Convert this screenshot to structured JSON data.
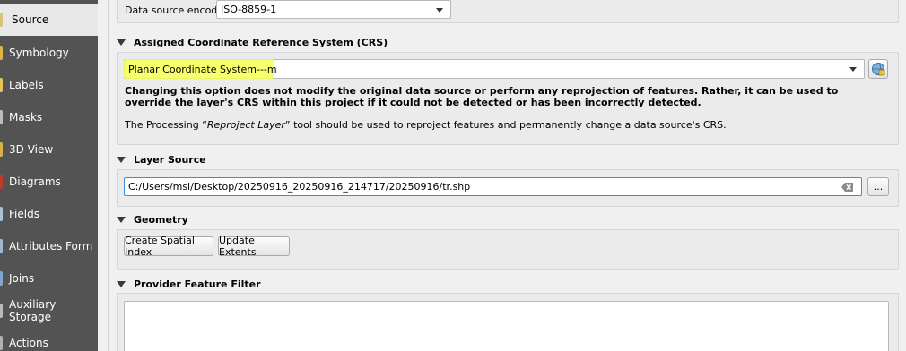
{
  "sidebar": {
    "items": [
      {
        "label": "Source",
        "icon": "source-icon"
      },
      {
        "label": "Symbology",
        "icon": "symbology-icon"
      },
      {
        "label": "Labels",
        "icon": "labels-icon"
      },
      {
        "label": "Masks",
        "icon": "masks-icon"
      },
      {
        "label": "3D View",
        "icon": "3d-view-icon"
      },
      {
        "label": "Diagrams",
        "icon": "diagrams-icon"
      },
      {
        "label": "Fields",
        "icon": "fields-icon"
      },
      {
        "label": "Attributes Form",
        "icon": "attributes-form-icon"
      },
      {
        "label": "Joins",
        "icon": "joins-icon"
      },
      {
        "label": "Auxiliary Storage",
        "icon": "auxiliary-storage-icon"
      },
      {
        "label": "Actions",
        "icon": "actions-icon"
      }
    ],
    "selected": "Source"
  },
  "encoding": {
    "label": "Data source encoding",
    "value": "ISO-8859-1"
  },
  "crs": {
    "header": "Assigned Coordinate Reference System (CRS)",
    "value": "Planar Coordinate System---m",
    "warning": "Changing this option does not modify the original data source or perform any reprojection of features. Rather, it can be used to override the layer's CRS within this project if it could not be detected or has been incorrectly detected.",
    "note_prefix": "The Processing “",
    "note_tool": "Reproject Layer",
    "note_suffix": "” tool should be used to reproject features and permanently change a data source's CRS."
  },
  "layer_source": {
    "header": "Layer Source",
    "path": "C:/Users/msi/Desktop/20250916_20250916_214717/20250916/tr.shp",
    "browse_label": "..."
  },
  "geometry": {
    "header": "Geometry",
    "create_index_label": "Create Spatial Index",
    "update_extents_label": "Update Extents"
  },
  "filter": {
    "header": "Provider Feature Filter"
  },
  "colors": {
    "sidebar_bg": "#535353",
    "highlight": "#f6ff52",
    "focus_border": "#3b8fd6"
  }
}
